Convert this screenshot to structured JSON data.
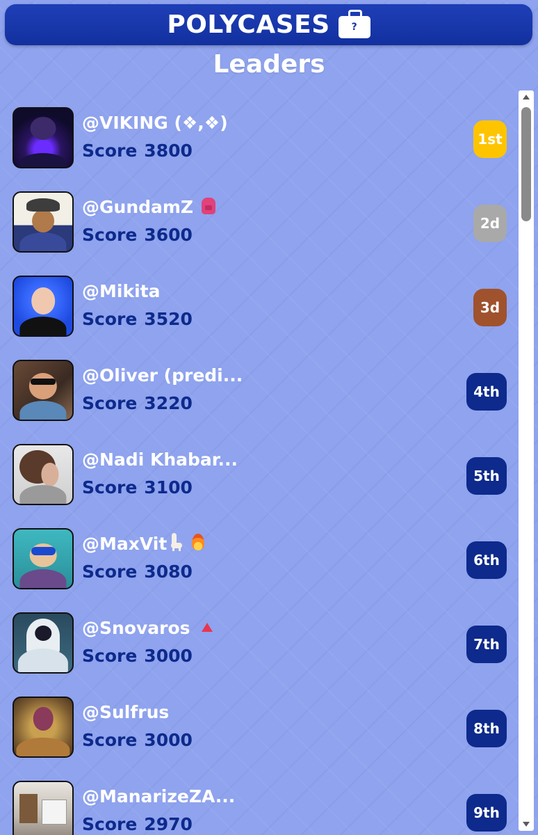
{
  "header": {
    "brand": "POLYCASES",
    "briefcase_mark": "?"
  },
  "page_title": "Leaders",
  "colors": {
    "header_bg": "#1a34a8",
    "page_bg": "#8fa3ee",
    "score_text": "#0d2a8c",
    "rank_gold": "#ffc400",
    "rank_silver": "#a9a9a9",
    "rank_bronze": "#a0522d",
    "rank_default": "#0d2a8c"
  },
  "leaders": [
    {
      "username": "@VIKING (❖,❖)",
      "score_label": "Score",
      "score": "3800",
      "rank": "1st",
      "rank_color": "#ffc400",
      "avatar": "dark-purple-warrior-avatar"
    },
    {
      "username": "@GundamZ",
      "emoji": "backpack-icon",
      "score_label": "Score",
      "score": "3600",
      "rank": "2d",
      "rank_color": "#a9a9a9",
      "avatar": "cartoon-man-cap-avatar"
    },
    {
      "username": "@Mikita",
      "score_label": "Score",
      "score": "3520",
      "rank": "3d",
      "rank_color": "#a0522d",
      "avatar": "man-portrait-avatar"
    },
    {
      "username": "@Oliver (predi...",
      "score_label": "Score",
      "score": "3220",
      "rank": "4th",
      "rank_color": "#0d2a8c",
      "avatar": "laughing-man-sunglasses-avatar"
    },
    {
      "username": "@Nadi Khabar...",
      "score_label": "Score",
      "score": "3100",
      "rank": "5th",
      "rank_color": "#0d2a8c",
      "avatar": "woman-curly-hair-avatar"
    },
    {
      "username": "@MaxVit",
      "emoji": "llama-fire-icons",
      "score_label": "Score",
      "score": "3080",
      "rank": "6th",
      "rank_color": "#0d2a8c",
      "avatar": "cartoon-masked-character-avatar"
    },
    {
      "username": "@Snovaros",
      "emoji": "triangle-icon",
      "score_label": "Score",
      "score": "3000",
      "rank": "7th",
      "rank_color": "#0d2a8c",
      "avatar": "hooded-figure-avatar"
    },
    {
      "username": "@Sulfrus",
      "score_label": "Score",
      "score": "3000",
      "rank": "8th",
      "rank_color": "#0d2a8c",
      "avatar": "tentacle-creature-avatar"
    },
    {
      "username": "@ManarizeZA...",
      "score_label": "Score",
      "score": "2970",
      "rank": "9th",
      "rank_color": "#0d2a8c",
      "avatar": "kitchen-interior-avatar"
    }
  ]
}
